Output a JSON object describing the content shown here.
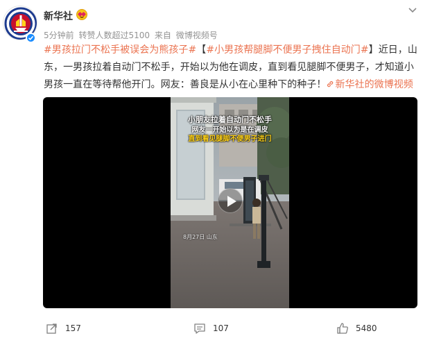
{
  "post": {
    "author": {
      "name": "新华社",
      "avatar_icon": "xinhua-logo",
      "verified_icon": "verified-check-icon",
      "badge_icon": "blush-emoji-icon",
      "avatar_ring_text": "XINHUA"
    },
    "meta": {
      "time": "5分钟前",
      "reposts": "转赞人数超过5100",
      "source_prefix": "来自",
      "source": "微博视频号"
    },
    "content": {
      "hashtag1": "#男孩拉门不松手被误会为熊孩子#",
      "bracket_open": "【",
      "hashtag2": "#小男孩帮腿脚不便男子拽住自动门#",
      "body": "】近日，山东，一男孩拉着自动门不松手，开始以为他在调皮，直到看见腿脚不便男子，才知道小男孩一直在等待帮他开门。网友：善良是从小在心里种下的种子！",
      "link_text": "新华社的微博视频",
      "link_icon": "link-icon"
    },
    "video": {
      "caption_line1": "小朋友拉着自动门不松手",
      "caption_line2": "网友一开始以为是在调皮",
      "caption_line3": "直到看见腿脚不便男子进门",
      "stamp": "8月27日 山东",
      "play_icon": "play-icon"
    }
  },
  "actions": {
    "share_count": "157",
    "comment_count": "107",
    "like_count": "5480"
  },
  "colors": {
    "link": "#eb7350",
    "meta": "#939393",
    "text": "#333333",
    "verified": "#1a8cff",
    "logo_blue": "#1d3b8f",
    "logo_red": "#c8102e"
  }
}
